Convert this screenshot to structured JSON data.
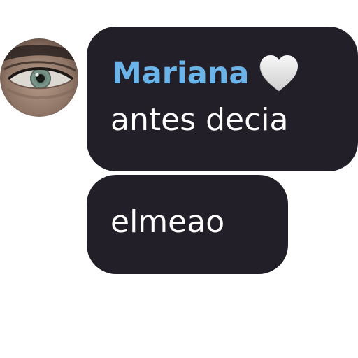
{
  "chat": {
    "messages": [
      {
        "sender": "Mariana",
        "sender_icon": "white-heart-icon",
        "text": "antes decia"
      },
      {
        "text": "elmeao"
      }
    ]
  },
  "colors": {
    "bubble_background": "#221f29",
    "sender_name": "#6ab4ea",
    "message_text": "#ffffff",
    "page_background": "#ffffff"
  }
}
